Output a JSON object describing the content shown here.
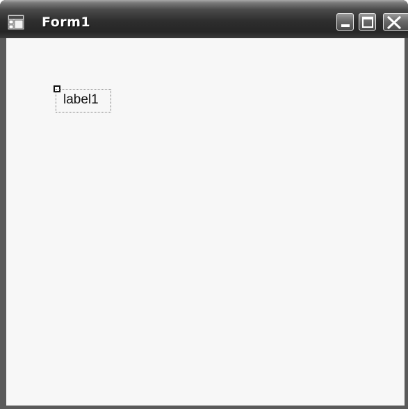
{
  "window": {
    "title": "Form1"
  },
  "caption_buttons": {
    "minimize": "minimize-icon",
    "maximize": "maximize-icon",
    "close": "close-icon"
  },
  "form": {
    "label_text": "label1"
  },
  "colors": {
    "titlebar": "#2e2e2e",
    "title_text": "#ffffff",
    "client_background": "#f7f7f7",
    "window_border": "#5a5a5a"
  }
}
